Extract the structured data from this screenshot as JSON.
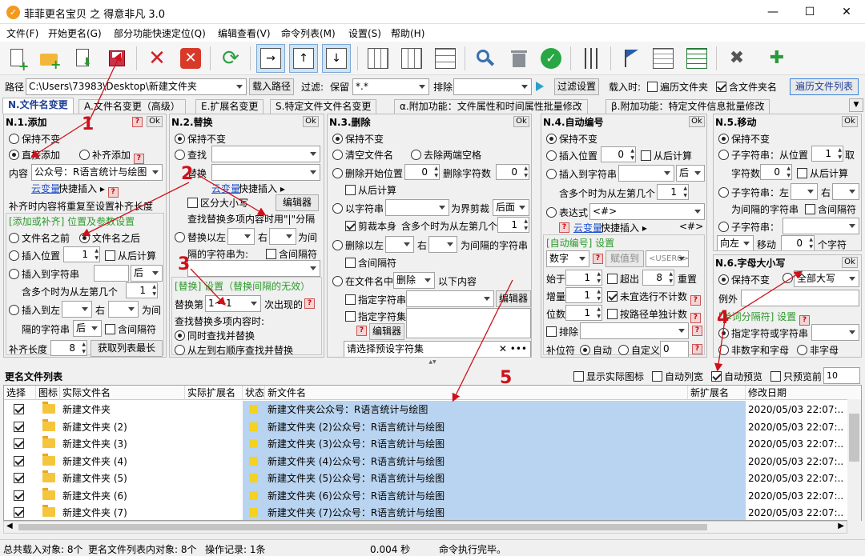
{
  "window": {
    "title": "菲菲更名宝贝 之 得意非凡 3.0",
    "minimize": "—",
    "maximize": "☐",
    "close": "✕"
  },
  "menu": [
    "文件(F)",
    "开始更名(G)",
    "部分功能快速定位(Q)",
    "编辑查看(V)",
    "命令列表(M)",
    "设置(S)",
    "帮助(H)"
  ],
  "pathbar": {
    "path_label": "路径",
    "path_value": "C:\\Users\\73983\\Desktop\\新建文件夹",
    "load_btn": "载入路径",
    "filter_label": "过滤:",
    "keep_label": "保留",
    "keep_value": "*.*",
    "exclude_label": "排除",
    "exclude_value": "",
    "filter_settings_btn": "过滤设置",
    "load_when": "载入时:",
    "opt_traverse": "遍历文件夹",
    "opt_include_folder": "含文件夹名",
    "traverse_list_btn": "遍历文件列表"
  },
  "tabs": [
    "N.文件名变更",
    "A.文件名变更（高级）",
    "E.扩展名变更",
    "S.特定文件文件名变更",
    "α.附加功能：文件属性和时间属性批量修改",
    "β.附加功能：特定文件信息批量修改"
  ],
  "ok": "Ok",
  "qmark": "?",
  "editor": "编辑器",
  "n1": {
    "title": "N.1.添加",
    "keep": "保持不变",
    "direct": "直接添加",
    "pad": "补齐添加",
    "content_label": "内容",
    "content_value": "公众号：R语言统计与绘图",
    "yunvar": "云变量",
    "quick_insert": "快捷插入",
    "pad_note": "补齐时内容将重复至设置补齐长度",
    "group_title": "[添加或补齐] 位置及参数设置",
    "before": "文件名之前",
    "after": "文件名之后",
    "insert_pos": "插入位置",
    "insert_pos_val": "1",
    "from_back": "从后计算",
    "insert_to_str": "插入到字符串",
    "after_word": "后",
    "multi_label": "含多个时为从左第几个",
    "multi_val": "1",
    "insert_left": "插入到左",
    "right": "右",
    "between_label": "隔的字符串",
    "between_val": "后",
    "include_sep": "含间隔符",
    "pad_len_label": "补齐长度",
    "pad_len_val": "8",
    "get_max_btn": "获取列表最长"
  },
  "n2": {
    "title": "N.2.替换",
    "keep": "保持不变",
    "find": "查找",
    "replace": "替换",
    "yunvar": "云变量",
    "quick_insert": "快捷插入",
    "case": "区分大小写",
    "note": "查找替换多项内容时用\"|\"分隔",
    "replace_between": "替换以左",
    "right": "右",
    "for_between": "为间",
    "between_str": "隔的字符串为:",
    "include_sep": "含间隔符",
    "group_title": "[替换] 设置（替换间隔的无效）",
    "replace_nth": "替换第",
    "nth_val": "1~-1",
    "nth_suffix": "次出现的",
    "multi_note": "查找替换多项内容时:",
    "opt_simul": "同时查找并替换",
    "opt_seq": "从左到右顺序查找并替换"
  },
  "n3": {
    "title": "N.3.删除",
    "keep": "保持不变",
    "clear_name": "清空文件名",
    "trim": "去除两端空格",
    "del_start": "删除开始位置",
    "del_start_val": "0",
    "del_count_label": "删除字符数",
    "del_count_val": "0",
    "from_back": "从后计算",
    "by_str": "以字符串",
    "cut_boundary": "为界剪裁",
    "cut_after": "后面",
    "cut_self": "剪裁本身",
    "multi_label": "含多个时为从左第几个",
    "multi_val": "1",
    "del_between": "删除以左",
    "right": "右",
    "between_str": "为间隔的字符串",
    "include_sep": "含间隔符",
    "in_name": "在文件名中",
    "del_mode": "删除",
    "below": "以下内容",
    "specify_str": "指定字符串",
    "specify_set": "指定字符集",
    "preset_placeholder": "请选择预设字符集"
  },
  "n4": {
    "title": "N.4.自动编号",
    "keep": "保持不变",
    "insert_pos": "插入位置",
    "insert_pos_val": "0",
    "from_back": "从后计算",
    "insert_to_str": "插入到字符串",
    "after_word": "后",
    "multi_label": "含多个时为从左第几个",
    "multi_val": "1",
    "expr": "表达式",
    "expr_val": "<#>",
    "yunvar": "云变量",
    "quick_insert": "快捷插入",
    "insert_tag": "<#>",
    "group_title": "[自动编号] 设置",
    "type_val": "数字",
    "assign": "赋值到",
    "user_val": "<USER0>",
    "start_label": "始于",
    "start_val": "1",
    "exceed": "超出",
    "exceed_val": "8",
    "reset": "重置",
    "step_label": "增量",
    "step_val": "1",
    "no_repeat": "未宜选行不计数",
    "digits_label": "位数",
    "digits_val": "1",
    "by_path": "按路径单独计数",
    "exclude": "排除",
    "pad_label": "补位符",
    "auto": "自动",
    "custom": "自定义",
    "custom_val": "0"
  },
  "n5": {
    "title": "N.5.移动",
    "keep": "保持不变",
    "substr_pos": "子字符串：从位置",
    "pos_val": "1",
    "take": "取",
    "char_count": "字符数",
    "count_val": "0",
    "from_back": "从后计算",
    "substr_left": "子字符串：左",
    "right": "右",
    "between_str": "为间隔的字符串",
    "include_sep": "含间隔符",
    "substr": "子字符串：",
    "dir_val": "向左",
    "move": "移动",
    "move_val": "0",
    "chars": "个字符"
  },
  "n6": {
    "title": "N.6.字母大小写",
    "keep": "保持不变",
    "case_val": "全部大写",
    "exception": "例外",
    "group_title": "[单词分隔符] 设置",
    "opt_specified": "指定字符或字符串",
    "opt_nonalnum": "非数字和字母",
    "opt_nonletter": "非字母"
  },
  "annotations": [
    "1",
    "2",
    "3",
    "4",
    "5"
  ],
  "list": {
    "title": "更名文件列表",
    "show_icon": "显示实际图标",
    "auto_width": "自动列宽",
    "auto_preview": "自动预览",
    "preview_only": "只预览前",
    "preview_count": "10",
    "columns": [
      "选择",
      "图标",
      "实际文件名",
      "实际扩展名",
      "状态",
      "新文件名",
      "新扩展名",
      "修改日期"
    ],
    "rows": [
      {
        "name": "新建文件夹",
        "new": "新建文件夹公众号：R语言统计与绘图",
        "date": "2020/05/03 22:07:.."
      },
      {
        "name": "新建文件夹 (2)",
        "new": "新建文件夹 (2)公众号：R语言统计与绘图",
        "date": "2020/05/03 22:07:.."
      },
      {
        "name": "新建文件夹 (3)",
        "new": "新建文件夹 (3)公众号：R语言统计与绘图",
        "date": "2020/05/03 22:07:.."
      },
      {
        "name": "新建文件夹 (4)",
        "new": "新建文件夹 (4)公众号：R语言统计与绘图",
        "date": "2020/05/03 22:07:.."
      },
      {
        "name": "新建文件夹 (5)",
        "new": "新建文件夹 (5)公众号：R语言统计与绘图",
        "date": "2020/05/03 22:07:.."
      },
      {
        "name": "新建文件夹 (6)",
        "new": "新建文件夹 (6)公众号：R语言统计与绘图",
        "date": "2020/05/03 22:07:.."
      },
      {
        "name": "新建文件夹 (7)",
        "new": "新建文件夹 (7)公众号：R语言统计与绘图",
        "date": "2020/05/03 22:07:.."
      }
    ]
  },
  "status": {
    "total": "总共载入对象: 8个",
    "in_list": "更名文件列表内对象: 8个",
    "ops": "操作记录: 1条",
    "time": "0.004 秒",
    "msg": "命令执行完毕。"
  }
}
